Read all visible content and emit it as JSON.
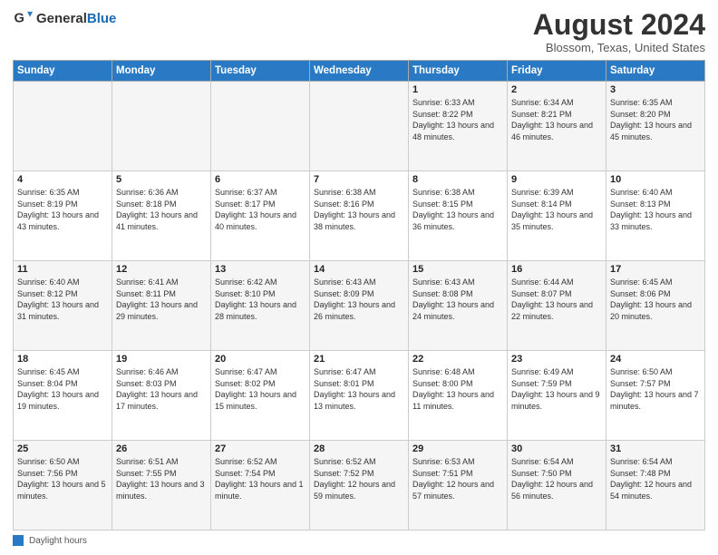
{
  "logo": {
    "general": "General",
    "blue": "Blue"
  },
  "title": "August 2024",
  "subtitle": "Blossom, Texas, United States",
  "days_of_week": [
    "Sunday",
    "Monday",
    "Tuesday",
    "Wednesday",
    "Thursday",
    "Friday",
    "Saturday"
  ],
  "footer_label": "Daylight hours",
  "weeks": [
    [
      {
        "day": "",
        "info": ""
      },
      {
        "day": "",
        "info": ""
      },
      {
        "day": "",
        "info": ""
      },
      {
        "day": "",
        "info": ""
      },
      {
        "day": "1",
        "info": "Sunrise: 6:33 AM\nSunset: 8:22 PM\nDaylight: 13 hours and 48 minutes."
      },
      {
        "day": "2",
        "info": "Sunrise: 6:34 AM\nSunset: 8:21 PM\nDaylight: 13 hours and 46 minutes."
      },
      {
        "day": "3",
        "info": "Sunrise: 6:35 AM\nSunset: 8:20 PM\nDaylight: 13 hours and 45 minutes."
      }
    ],
    [
      {
        "day": "4",
        "info": "Sunrise: 6:35 AM\nSunset: 8:19 PM\nDaylight: 13 hours and 43 minutes."
      },
      {
        "day": "5",
        "info": "Sunrise: 6:36 AM\nSunset: 8:18 PM\nDaylight: 13 hours and 41 minutes."
      },
      {
        "day": "6",
        "info": "Sunrise: 6:37 AM\nSunset: 8:17 PM\nDaylight: 13 hours and 40 minutes."
      },
      {
        "day": "7",
        "info": "Sunrise: 6:38 AM\nSunset: 8:16 PM\nDaylight: 13 hours and 38 minutes."
      },
      {
        "day": "8",
        "info": "Sunrise: 6:38 AM\nSunset: 8:15 PM\nDaylight: 13 hours and 36 minutes."
      },
      {
        "day": "9",
        "info": "Sunrise: 6:39 AM\nSunset: 8:14 PM\nDaylight: 13 hours and 35 minutes."
      },
      {
        "day": "10",
        "info": "Sunrise: 6:40 AM\nSunset: 8:13 PM\nDaylight: 13 hours and 33 minutes."
      }
    ],
    [
      {
        "day": "11",
        "info": "Sunrise: 6:40 AM\nSunset: 8:12 PM\nDaylight: 13 hours and 31 minutes."
      },
      {
        "day": "12",
        "info": "Sunrise: 6:41 AM\nSunset: 8:11 PM\nDaylight: 13 hours and 29 minutes."
      },
      {
        "day": "13",
        "info": "Sunrise: 6:42 AM\nSunset: 8:10 PM\nDaylight: 13 hours and 28 minutes."
      },
      {
        "day": "14",
        "info": "Sunrise: 6:43 AM\nSunset: 8:09 PM\nDaylight: 13 hours and 26 minutes."
      },
      {
        "day": "15",
        "info": "Sunrise: 6:43 AM\nSunset: 8:08 PM\nDaylight: 13 hours and 24 minutes."
      },
      {
        "day": "16",
        "info": "Sunrise: 6:44 AM\nSunset: 8:07 PM\nDaylight: 13 hours and 22 minutes."
      },
      {
        "day": "17",
        "info": "Sunrise: 6:45 AM\nSunset: 8:06 PM\nDaylight: 13 hours and 20 minutes."
      }
    ],
    [
      {
        "day": "18",
        "info": "Sunrise: 6:45 AM\nSunset: 8:04 PM\nDaylight: 13 hours and 19 minutes."
      },
      {
        "day": "19",
        "info": "Sunrise: 6:46 AM\nSunset: 8:03 PM\nDaylight: 13 hours and 17 minutes."
      },
      {
        "day": "20",
        "info": "Sunrise: 6:47 AM\nSunset: 8:02 PM\nDaylight: 13 hours and 15 minutes."
      },
      {
        "day": "21",
        "info": "Sunrise: 6:47 AM\nSunset: 8:01 PM\nDaylight: 13 hours and 13 minutes."
      },
      {
        "day": "22",
        "info": "Sunrise: 6:48 AM\nSunset: 8:00 PM\nDaylight: 13 hours and 11 minutes."
      },
      {
        "day": "23",
        "info": "Sunrise: 6:49 AM\nSunset: 7:59 PM\nDaylight: 13 hours and 9 minutes."
      },
      {
        "day": "24",
        "info": "Sunrise: 6:50 AM\nSunset: 7:57 PM\nDaylight: 13 hours and 7 minutes."
      }
    ],
    [
      {
        "day": "25",
        "info": "Sunrise: 6:50 AM\nSunset: 7:56 PM\nDaylight: 13 hours and 5 minutes."
      },
      {
        "day": "26",
        "info": "Sunrise: 6:51 AM\nSunset: 7:55 PM\nDaylight: 13 hours and 3 minutes."
      },
      {
        "day": "27",
        "info": "Sunrise: 6:52 AM\nSunset: 7:54 PM\nDaylight: 13 hours and 1 minute."
      },
      {
        "day": "28",
        "info": "Sunrise: 6:52 AM\nSunset: 7:52 PM\nDaylight: 12 hours and 59 minutes."
      },
      {
        "day": "29",
        "info": "Sunrise: 6:53 AM\nSunset: 7:51 PM\nDaylight: 12 hours and 57 minutes."
      },
      {
        "day": "30",
        "info": "Sunrise: 6:54 AM\nSunset: 7:50 PM\nDaylight: 12 hours and 56 minutes."
      },
      {
        "day": "31",
        "info": "Sunrise: 6:54 AM\nSunset: 7:48 PM\nDaylight: 12 hours and 54 minutes."
      }
    ]
  ]
}
